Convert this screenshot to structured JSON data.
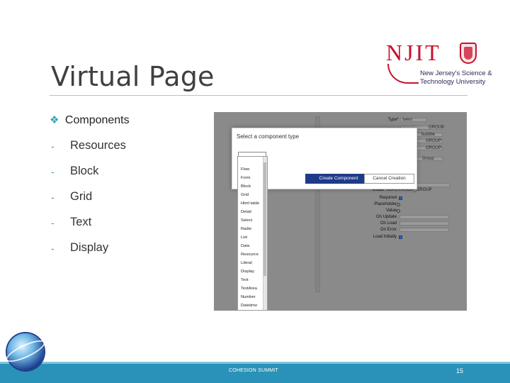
{
  "slide": {
    "title": "Virtual Page",
    "logo": {
      "letters": "NJIT",
      "line1": "New Jersey's Science &",
      "line2": "Technology University"
    },
    "heading": "Components",
    "bullets": [
      "Resources",
      "Block",
      "Grid",
      "Text",
      "Display"
    ],
    "footer": "COHESION SUMMIT",
    "page_number": "15"
  },
  "screenshot": {
    "dialog_title": "Select a component type",
    "create_button": "Create Component",
    "cancel_button": "Cancel Creation",
    "options": [
      "Flow",
      "Form",
      "Block",
      "Grid",
      "Html table",
      "Detail",
      "Select",
      "Radio",
      "List",
      "Data",
      "Resource",
      "Literal",
      "Display",
      "Text",
      "TextArea",
      "Number",
      "Datetime"
    ],
    "bg_fields": [
      {
        "label": "Type*",
        "value": "Select"
      },
      {
        "label": "Model",
        "value": "SUPERVISOR_GROUP"
      },
      {
        "label": "Required",
        "value": ""
      },
      {
        "label": "Placeholder",
        "value": ""
      },
      {
        "label": "Value",
        "value": ""
      },
      {
        "label": "On Update",
        "value": ""
      },
      {
        "label": "On Load",
        "value": ""
      },
      {
        "label": "On Error",
        "value": ""
      },
      {
        "label": "Load Initially",
        "value": ""
      }
    ],
    "bg_right_fragments": [
      "GROUP",
      "Subtitle",
      "GROUP",
      "GROUP",
      "Group"
    ]
  },
  "colors": {
    "accent": "#3aa3b3",
    "footer": "#2a92b8",
    "brand_red": "#c8102e",
    "create_button": "#1e3a8a"
  },
  "icons": {
    "bullet": "diamond-bullet-icon",
    "globe_logo": "globe-logo-icon"
  }
}
